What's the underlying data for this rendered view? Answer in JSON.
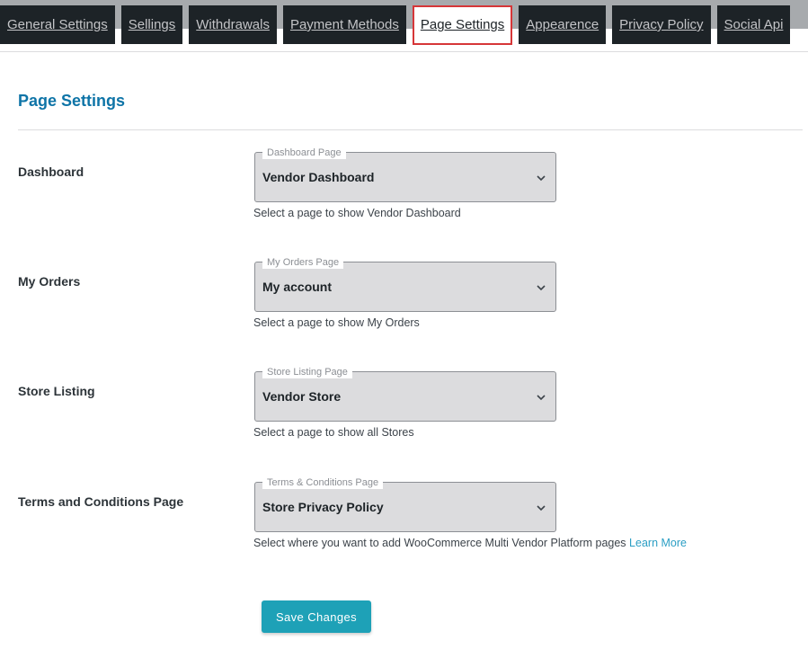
{
  "tabs": [
    {
      "label": "General Settings"
    },
    {
      "label": "Sellings"
    },
    {
      "label": "Withdrawals"
    },
    {
      "label": "Payment Methods"
    },
    {
      "label": "Page Settings",
      "active": true
    },
    {
      "label": "Appearence"
    },
    {
      "label": "Privacy Policy"
    },
    {
      "label": "Social Api"
    }
  ],
  "page_title": "Page Settings",
  "fields": {
    "dashboard": {
      "label": "Dashboard",
      "legend": "Dashboard Page",
      "value": "Vendor Dashboard",
      "help": "Select a page to show Vendor Dashboard"
    },
    "orders": {
      "label": "My Orders",
      "legend": "My Orders Page",
      "value": "My account",
      "help": "Select a page to show My Orders"
    },
    "store": {
      "label": "Store Listing",
      "legend": "Store Listing Page",
      "value": "Vendor Store",
      "help": "Select a page to show all Stores"
    },
    "terms": {
      "label": "Terms and Conditions Page",
      "legend": "Terms & Conditions Page",
      "value": "Store Privacy Policy",
      "help": "Select where you want to add WooCommerce Multi Vendor Platform pages",
      "link": "Learn More"
    }
  },
  "save_label": "Save Changes",
  "colors": {
    "accent": "#0e74a7",
    "button": "#1ea1b7",
    "tab_bg": "#1d2327",
    "active_border": "#d63638"
  }
}
